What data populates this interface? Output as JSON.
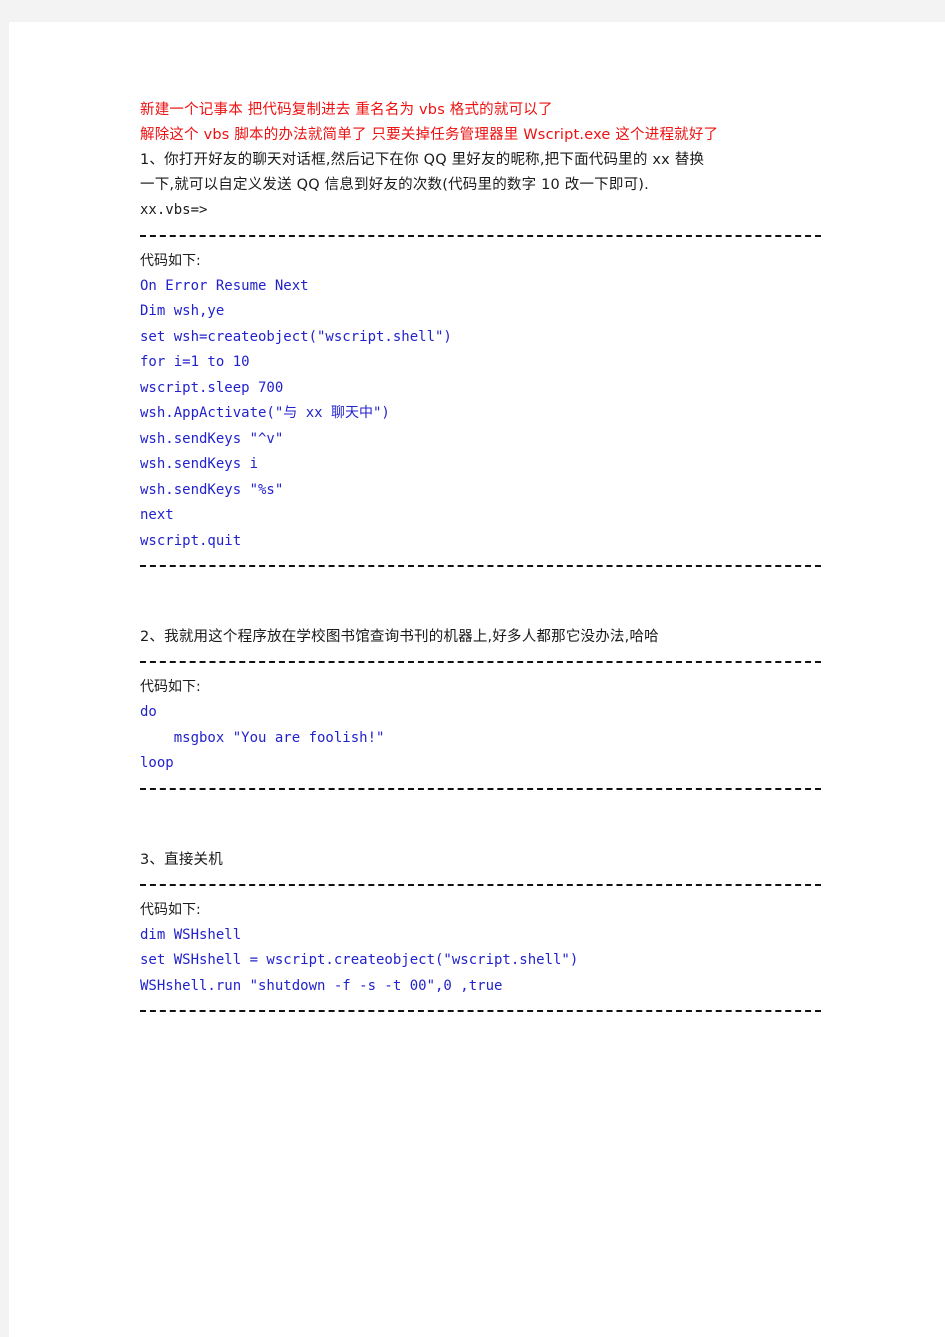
{
  "document": {
    "colors": {
      "page_background": "#ffffff",
      "margin_background": "#f3f3f3",
      "body_text": "#1a1a1a",
      "notice_text": "#ee1111",
      "code_text": "#2222cc"
    },
    "notice": [
      "新建一个记事本 把代码复制进去 重名名为 vbs 格式的就可以了",
      "解除这个 vbs 脚本的办法就简单了 只要关掉任务管理器里 Wscript.exe 这个进程就好了"
    ],
    "sections": [
      {
        "heading": [
          "1、你打开好友的聊天对话框,然后记下在你 QQ 里好友的昵称,把下面代码里的 xx 替换",
          "一下,就可以自定义发送 QQ 信息到好友的次数(代码里的数字 10 改一下即可).",
          "xx.vbs=>"
        ],
        "caption": "代码如下:",
        "code": [
          "On Error Resume Next",
          "Dim wsh,ye",
          "set wsh=createobject(\"wscript.shell\")",
          "for i=1 to 10",
          "wscript.sleep 700",
          "wsh.AppActivate(\"与 xx 聊天中\")",
          "wsh.sendKeys \"^v\"",
          "wsh.sendKeys i",
          "wsh.sendKeys \"%s\"",
          "next",
          "wscript.quit"
        ]
      },
      {
        "heading": [
          "2、我就用这个程序放在学校图书馆查询书刊的机器上,好多人都那它没办法,哈哈"
        ],
        "caption": "代码如下:",
        "code": [
          "do",
          "    msgbox \"You are foolish!\"",
          "loop"
        ]
      },
      {
        "heading": [
          "3、直接关机"
        ],
        "caption": "代码如下:",
        "code": [
          "dim WSHshell",
          "set WSHshell = wscript.createobject(\"wscript.shell\")",
          "WSHshell.run \"shutdown -f -s -t 00\",0 ,true"
        ]
      }
    ]
  }
}
